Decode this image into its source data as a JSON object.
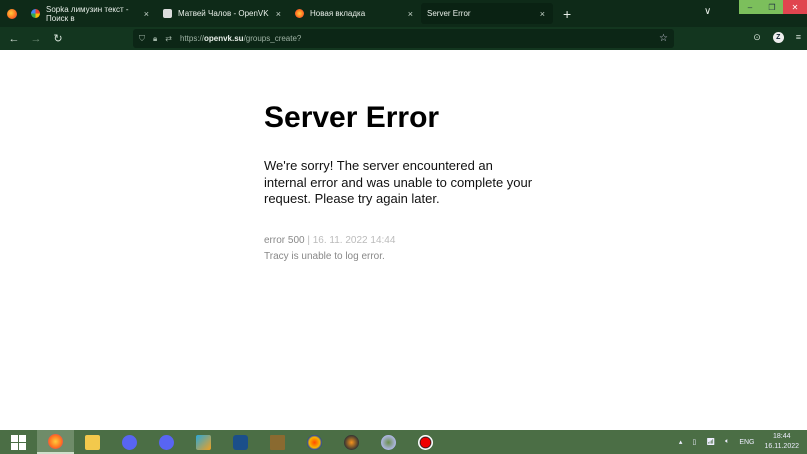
{
  "browser": {
    "tabs": [
      {
        "title": "Sopka лимузин текст - Поиск в",
        "icon": "google-icon",
        "active": false
      },
      {
        "title": "Матвей Чалов - OpenVK",
        "icon": "openvk-icon",
        "active": false
      },
      {
        "title": "Новая вкладка",
        "icon": "firefox-icon",
        "active": false
      },
      {
        "title": "Server Error",
        "icon": "",
        "active": true
      }
    ],
    "new_tab": "+",
    "tab_close": "×",
    "url_host": "openvk.su",
    "url_prefix": "https://",
    "url_path": "/groups_create?",
    "profile_letter": "Z"
  },
  "page": {
    "title": "Server Error",
    "message": "We're sorry! The server encountered an internal error and was unable to complete your request. Please try again later.",
    "error_code": "error 500",
    "separator": "|",
    "error_date": "16. 11. 2022 14:44",
    "tracy_note": "Tracy is unable to log error."
  },
  "taskbar": {
    "apps": [
      "firefox",
      "file-explorer",
      "discord",
      "discord",
      "virtualbox-tool",
      "virtualbox",
      "dosbox",
      "audacity",
      "fl-studio",
      "app",
      "obs"
    ],
    "language": "ENG",
    "time": "18:44",
    "date": "16.11.2022"
  },
  "colors": {
    "tabbar": "#0e2a18",
    "toolbar": "#13361f",
    "taskbar": "#4b6e45"
  }
}
